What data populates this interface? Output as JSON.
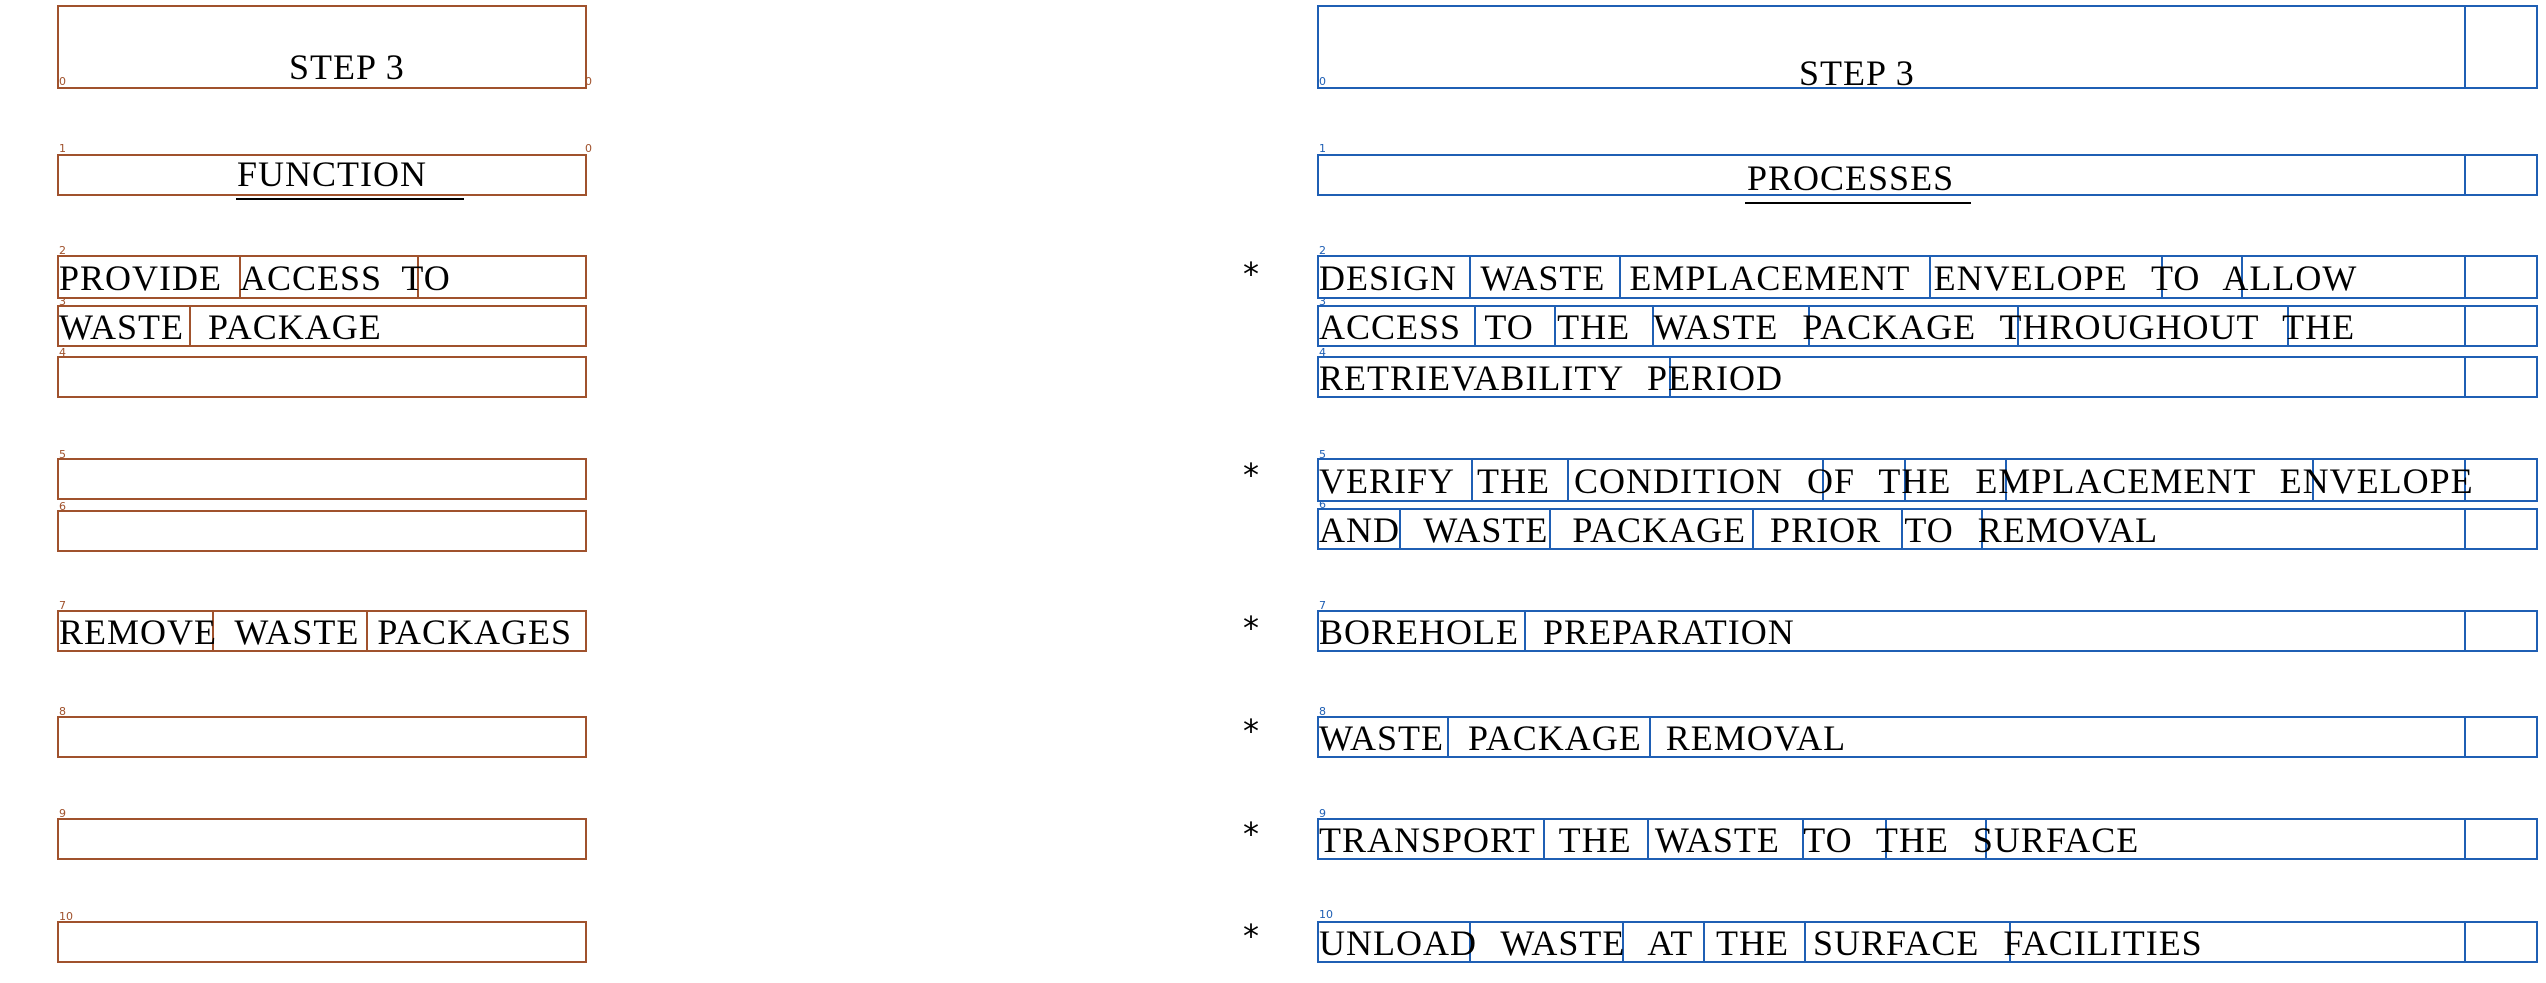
{
  "left": {
    "step": "STEP 3",
    "heading": "FUNCTION",
    "rows": [
      {
        "idx": "2",
        "end": "0",
        "text": "PROVIDE ACCESS TO"
      },
      {
        "idx": "3",
        "end": "0",
        "text": "WASTE PACKAGE"
      },
      {
        "idx": "4",
        "end": "0",
        "text": ""
      },
      {
        "idx": "5",
        "end": "0",
        "text": ""
      },
      {
        "idx": "6",
        "end": "0",
        "text": ""
      },
      {
        "idx": "7",
        "end": "0",
        "text": "REMOVE WASTE PACKAGES"
      },
      {
        "idx": "8",
        "end": "0",
        "text": ""
      },
      {
        "idx": "9",
        "end": "0",
        "text": ""
      },
      {
        "idx": "10",
        "end": "0",
        "text": ""
      }
    ],
    "step_idx": "0",
    "heading_idx": "1"
  },
  "right": {
    "step": "STEP 3",
    "heading": "PROCESSES",
    "step_idx": "0",
    "heading_idx": "1",
    "rows": [
      {
        "idx": "2",
        "text": "DESIGN WASTE EMPLACEMENT ENVELOPE TO ALLOW"
      },
      {
        "idx": "3",
        "text": "ACCESS TO THE WASTE PACKAGE THROUGHOUT THE"
      },
      {
        "idx": "4",
        "text": "RETRIEVABILITY PERIOD"
      },
      {
        "idx": "5",
        "text": "VERIFY THE CONDITION OF THE EMPLACEMENT ENVELOPE"
      },
      {
        "idx": "6",
        "text": "AND WASTE PACKAGE PRIOR TO REMOVAL"
      },
      {
        "idx": "7",
        "text": "BOREHOLE PREPARATION"
      },
      {
        "idx": "8",
        "text": "WASTE PACKAGE REMOVAL"
      },
      {
        "idx": "9",
        "text": "TRANSPORT THE WASTE TO THE SURFACE"
      },
      {
        "idx": "10",
        "text": "UNLOAD WASTE AT THE SURFACE FACILITIES"
      }
    ],
    "end_idx": "1"
  },
  "bullets": [
    "*",
    "*",
    "*",
    "*",
    "*",
    "*"
  ],
  "colors": {
    "left_boxes": "#a0522d",
    "right_boxes": "#1f5fb4"
  }
}
